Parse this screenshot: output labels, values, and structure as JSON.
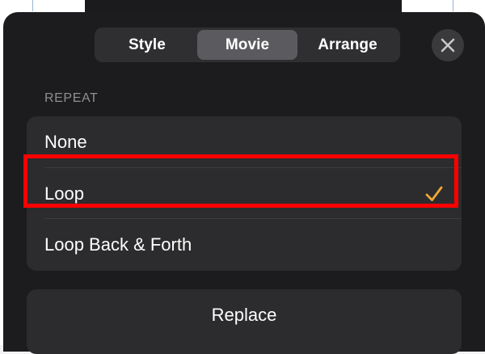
{
  "tabs": [
    {
      "label": "Style",
      "active": false
    },
    {
      "label": "Movie",
      "active": true
    },
    {
      "label": "Arrange",
      "active": false
    }
  ],
  "close_icon": "close-icon",
  "repeat": {
    "section_label": "REPEAT",
    "options": [
      {
        "label": "None",
        "selected": false
      },
      {
        "label": "Loop",
        "selected": true
      },
      {
        "label": "Loop Back & Forth",
        "selected": false
      }
    ],
    "check_icon": "checkmark-icon"
  },
  "replace_label": "Replace",
  "colors": {
    "sheet_bg": "#1c1c1e",
    "group_bg": "#2c2c2e",
    "accent_check": "#f0a733",
    "highlight": "#ff0000"
  }
}
